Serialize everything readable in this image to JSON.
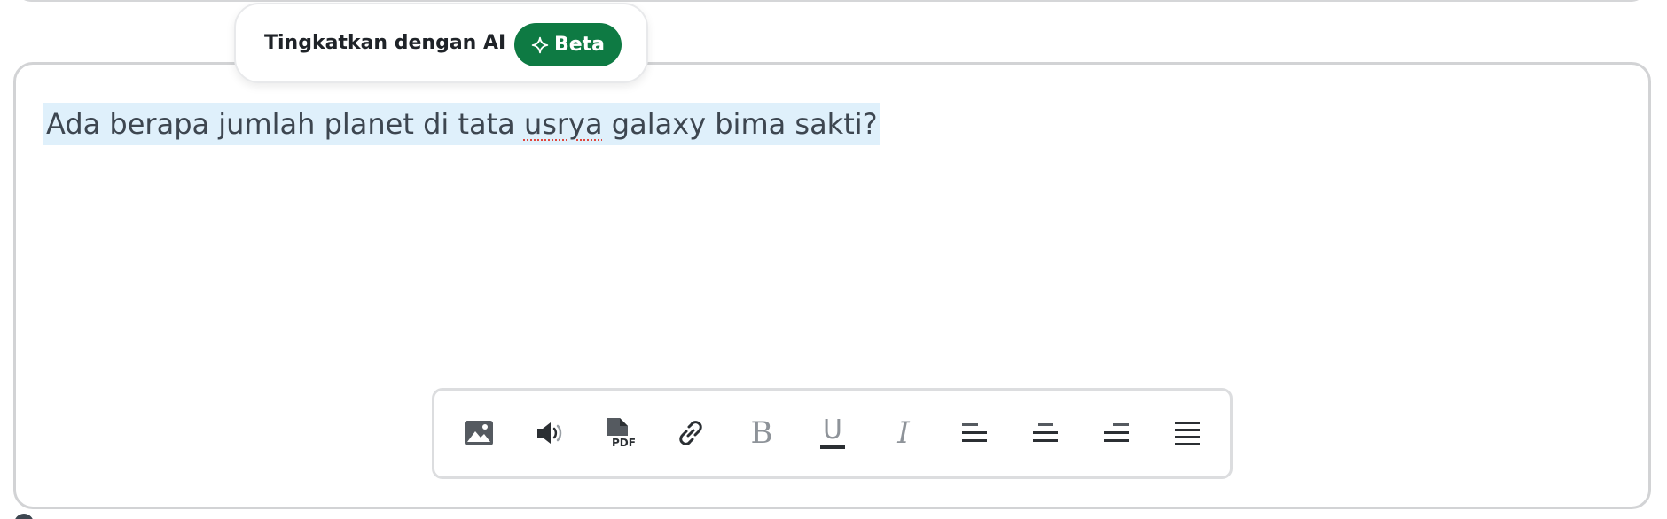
{
  "ai_enhance": {
    "label": "Tingkatkan dengan AI",
    "beta_label": "Beta",
    "accent_color": "#0e7a43"
  },
  "editor": {
    "question_before": "Ada berapa jumlah planet di tata ",
    "question_misspelled": "usrya",
    "question_after": " galaxy bima sakti?"
  },
  "toolbar": {
    "tools": [
      {
        "id": "image",
        "icon": "image-icon"
      },
      {
        "id": "audio",
        "icon": "speaker-icon"
      },
      {
        "id": "pdf",
        "icon": "pdf-icon",
        "badge": "PDF"
      },
      {
        "id": "link",
        "icon": "link-icon"
      },
      {
        "id": "bold",
        "icon": "bold-icon",
        "glyph": "B"
      },
      {
        "id": "underline",
        "icon": "underline-icon",
        "glyph": "U"
      },
      {
        "id": "italic",
        "icon": "italic-icon",
        "glyph": "I"
      },
      {
        "id": "align-left",
        "icon": "align-left-icon"
      },
      {
        "id": "align-center",
        "icon": "align-center-icon"
      },
      {
        "id": "align-right",
        "icon": "align-right-icon"
      },
      {
        "id": "align-justify",
        "icon": "align-justify-icon"
      }
    ]
  }
}
